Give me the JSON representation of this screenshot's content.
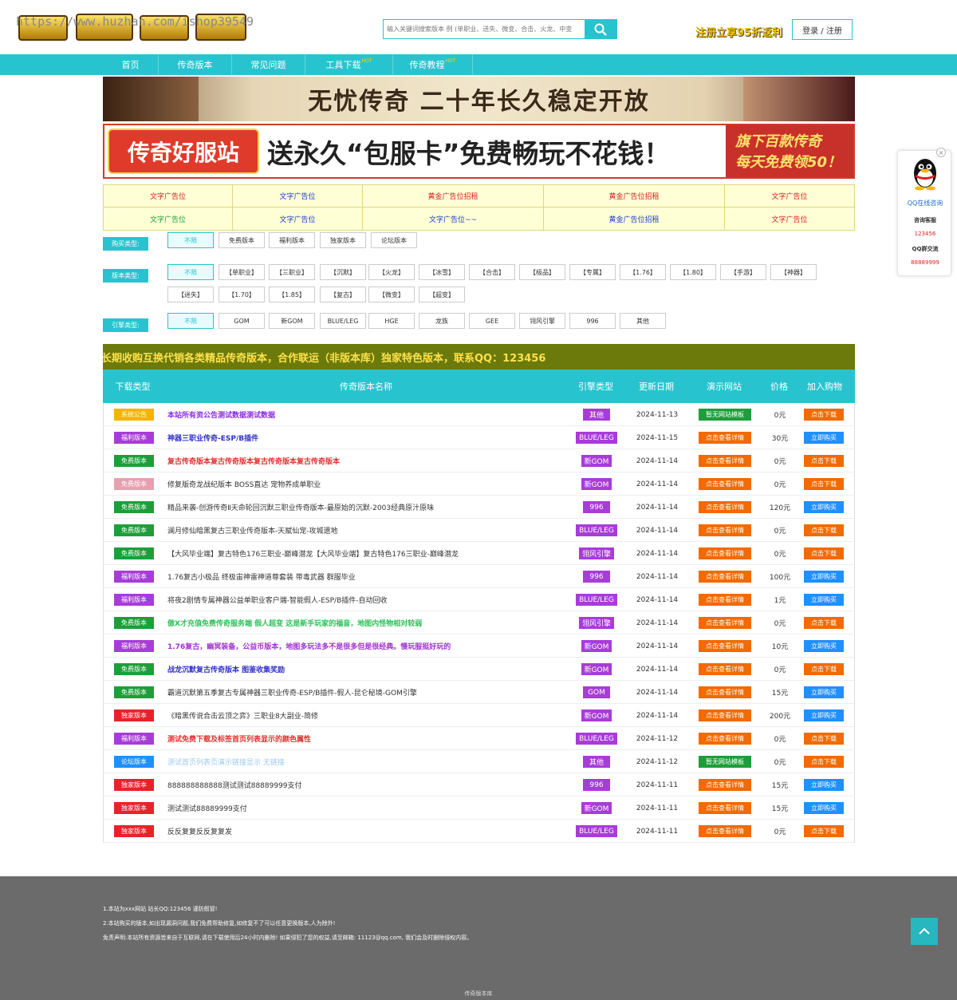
{
  "header": {
    "watermark": "https://www.huzhan.com/ishop39549",
    "search_placeholder": "输入关键词搜索版本 例 (单职业、送失、微变、合击、火龙、中变",
    "promo": "注册立享95折返利",
    "login": "登录 / 注册"
  },
  "nav": [
    {
      "label": "首页",
      "hot": ""
    },
    {
      "label": "传奇版本",
      "hot": ""
    },
    {
      "label": "常见问题",
      "hot": ""
    },
    {
      "label": "工具下载",
      "hot": "HOT"
    },
    {
      "label": "传奇教程",
      "hot": "HOT"
    }
  ],
  "banner1": "无忧传奇 二十年长久稳定开放",
  "banner2": {
    "badge": "传奇好服站",
    "main": "送永久“包服卡”免费畅玩不花钱！",
    "side1": "旗下百款传奇",
    "side2": "每天免费领50！"
  },
  "ads": [
    [
      "文字广告位",
      "文字广告位",
      "黄金广告位招租",
      "黄金广告位招租",
      "文字广告位"
    ],
    [
      "文字广告位",
      "文字广告位",
      "文字广告位~~",
      "黄金广告位招租",
      "文字广告位"
    ]
  ],
  "filters": {
    "buy": {
      "label": "购买类型:",
      "options": [
        "不限",
        "免费版本",
        "福利版本",
        "独家版本",
        "论坛版本"
      ]
    },
    "version": {
      "label": "版本类型:",
      "options": [
        "不限",
        "【单职业】",
        "【三职业】",
        "【沉默】",
        "【火龙】",
        "【冰雪】",
        "【合击】",
        "【极品】",
        "【专属】",
        "【1.76】",
        "【1.80】",
        "【手游】",
        "【神器】",
        "【迷失】",
        "【1.70】",
        "【1.85】",
        "【复古】",
        "【微变】",
        "【超变】"
      ]
    },
    "engine": {
      "label": "引擎类型:",
      "options": [
        "不限",
        "GOM",
        "新GOM",
        "BLUE/LEG",
        "HGE",
        "龙族",
        "GEE",
        "翎风引擎",
        "996",
        "其他"
      ]
    }
  },
  "ticker": "长期收购互换代销各类精品传奇版本，合作联运（非版本库）独家特色版本，联系QQ：123456",
  "table": {
    "headers": [
      "下载类型",
      "传奇版本名称",
      "引擎类型",
      "更新日期",
      "演示网站",
      "价格",
      "加入购物"
    ],
    "rows": [
      {
        "type": "系统公告",
        "typeColor": "#f5b400",
        "name": "本站所有资公告测试数据测试数据",
        "nameColor": "#8a2be2",
        "nameBold": true,
        "engine": "其他",
        "date": "2024-11-13",
        "demo": "暂无网站模板",
        "demoColor": "#1e9e3a",
        "price": "0元",
        "action": "点击下载",
        "actionColor": "#f26a00"
      },
      {
        "type": "福利版本",
        "typeColor": "#a83cd8",
        "name": "神器三职业传奇-ESP/B插件",
        "nameColor": "#3030c8",
        "nameBold": true,
        "engine": "BLUE/LEG",
        "date": "2024-11-15",
        "demo": "点击查看详情",
        "demoColor": "#f26a00",
        "price": "30元",
        "action": "立即购买",
        "actionColor": "#1e90ff"
      },
      {
        "type": "免费版本",
        "typeColor": "#1e9e3a",
        "name": "复古传奇版本复古传奇版本复古传奇版本复古传奇版本",
        "nameColor": "#e03030",
        "nameBold": true,
        "engine": "新GOM",
        "date": "2024-11-14",
        "demo": "点击查看详情",
        "demoColor": "#f26a00",
        "price": "0元",
        "action": "点击下载",
        "actionColor": "#f26a00"
      },
      {
        "type": "免费版本",
        "typeColor": "#e8a0b0",
        "name": "修复版奇龙战纪版本 BOSS直达 宠物养成单职业",
        "nameColor": "#333",
        "nameBold": false,
        "engine": "新GOM",
        "date": "2024-11-14",
        "demo": "点击查看详情",
        "demoColor": "#f26a00",
        "price": "0元",
        "action": "点击下载",
        "actionColor": "#f26a00"
      },
      {
        "type": "免费版本",
        "typeColor": "#1e9e3a",
        "name": "精品来袭-创游传奇Ⅱ天命轮回沉默三职业传奇版本-最原始的沉默-2003经典原汁原味",
        "nameColor": "#333",
        "nameBold": false,
        "engine": "996",
        "date": "2024-11-14",
        "demo": "点击查看详情",
        "demoColor": "#f26a00",
        "price": "120元",
        "action": "立即购买",
        "actionColor": "#1e90ff"
      },
      {
        "type": "免费版本",
        "typeColor": "#1e9e3a",
        "name": "澜月修仙暗黑复古三职业传奇版本-天赋仙宠-攻城遗地",
        "nameColor": "#333",
        "nameBold": false,
        "engine": "BLUE/LEG",
        "date": "2024-11-14",
        "demo": "点击查看详情",
        "demoColor": "#f26a00",
        "price": "0元",
        "action": "点击下载",
        "actionColor": "#f26a00"
      },
      {
        "type": "免费版本",
        "typeColor": "#1e9e3a",
        "name": "【大风毕业端】复古特色176三职业-巅峰潜龙【大风毕业端】复古特色176三职业-巅峰潜龙",
        "nameColor": "#333",
        "nameBold": false,
        "engine": "翎风引擎",
        "date": "2024-11-14",
        "demo": "点击查看详情",
        "demoColor": "#f26a00",
        "price": "0元",
        "action": "点击下载",
        "actionColor": "#f26a00"
      },
      {
        "type": "福利版本",
        "typeColor": "#a83cd8",
        "name": "1.76复古小极品 终极宙神雷神道尊套装 带毒武器 群服毕业",
        "nameColor": "#333",
        "nameBold": false,
        "engine": "996",
        "date": "2024-11-14",
        "demo": "点击查看详情",
        "demoColor": "#f26a00",
        "price": "100元",
        "action": "立即购买",
        "actionColor": "#1e90ff"
      },
      {
        "type": "福利版本",
        "typeColor": "#a83cd8",
        "name": "将夜2剧情专属神器公益单职业客户端-智能假人-ESP/B插件-自动回收",
        "nameColor": "#333",
        "nameBold": false,
        "engine": "BLUE/LEG",
        "date": "2024-11-14",
        "demo": "点击查看详情",
        "demoColor": "#f26a00",
        "price": "1元",
        "action": "立即购买",
        "actionColor": "#1e90ff"
      },
      {
        "type": "免费版本",
        "typeColor": "#1e9e3a",
        "name": "傲X才充值免费传奇服务端 假人超变 这是新手玩家的福音，地图内怪物相对较弱",
        "nameColor": "#2ec05a",
        "nameBold": true,
        "engine": "翎风引擎",
        "date": "2024-11-14",
        "demo": "点击查看详情",
        "demoColor": "#f26a00",
        "price": "0元",
        "action": "点击下载",
        "actionColor": "#f26a00"
      },
      {
        "type": "福利版本",
        "typeColor": "#a83cd8",
        "name": "1.76复古，幽冥装备，公益币版本，地图多玩法多不是很多但是很经典。慢玩服挺好玩的",
        "nameColor": "#a030d0",
        "nameBold": true,
        "engine": "新GOM",
        "date": "2024-11-14",
        "demo": "点击查看详情",
        "demoColor": "#f26a00",
        "price": "10元",
        "action": "立即购买",
        "actionColor": "#1e90ff"
      },
      {
        "type": "免费版本",
        "typeColor": "#1e9e3a",
        "name": "战龙沉默复古传奇版本 图鉴收集奖励",
        "nameColor": "#3030c8",
        "nameBold": true,
        "engine": "新GOM",
        "date": "2024-11-14",
        "demo": "点击查看详情",
        "demoColor": "#f26a00",
        "price": "0元",
        "action": "点击下载",
        "actionColor": "#f26a00"
      },
      {
        "type": "免费版本",
        "typeColor": "#1e9e3a",
        "name": "霸道沉默第五季复古专属神器三职业传奇-ESP/B插件-假人-昆仑秘境-GOM引擎",
        "nameColor": "#333",
        "nameBold": false,
        "engine": "GOM",
        "date": "2024-11-14",
        "demo": "点击查看详情",
        "demoColor": "#f26a00",
        "price": "15元",
        "action": "立即购买",
        "actionColor": "#1e90ff"
      },
      {
        "type": "独家版本",
        "typeColor": "#e8222a",
        "name": "《暗黑传说合击云顶之弈》三职业8大副业-简修",
        "nameColor": "#333",
        "nameBold": false,
        "engine": "新GOM",
        "date": "2024-11-14",
        "demo": "点击查看详情",
        "demoColor": "#f26a00",
        "price": "200元",
        "action": "立即购买",
        "actionColor": "#1e90ff"
      },
      {
        "type": "福利版本",
        "typeColor": "#a83cd8",
        "name": "测试免费下载及标签首页列表显示的颜色属性",
        "nameColor": "#e03030",
        "nameBold": true,
        "engine": "BLUE/LEG",
        "date": "2024-11-12",
        "demo": "点击查看详情",
        "demoColor": "#f26a00",
        "price": "0元",
        "action": "点击下载",
        "actionColor": "#f26a00"
      },
      {
        "type": "论坛版本",
        "typeColor": "#1e90ff",
        "name": "测试首页列表页演示链接显示 无链接",
        "nameColor": "#9ec8f0",
        "nameBold": false,
        "engine": "其他",
        "date": "2024-11-12",
        "demo": "暂无网站模板",
        "demoColor": "#1e9e3a",
        "price": "0元",
        "action": "点击下载",
        "actionColor": "#f26a00"
      },
      {
        "type": "独家版本",
        "typeColor": "#e8222a",
        "name": "888888888888测试测试88889999支付",
        "nameColor": "#333",
        "nameBold": false,
        "engine": "996",
        "date": "2024-11-11",
        "demo": "点击查看详情",
        "demoColor": "#f26a00",
        "price": "15元",
        "action": "立即购买",
        "actionColor": "#1e90ff"
      },
      {
        "type": "独家版本",
        "typeColor": "#e8222a",
        "name": "测试测试88889999支付",
        "nameColor": "#333",
        "nameBold": false,
        "engine": "新GOM",
        "date": "2024-11-11",
        "demo": "点击查看详情",
        "demoColor": "#f26a00",
        "price": "15元",
        "action": "立即购买",
        "actionColor": "#1e90ff"
      },
      {
        "type": "独家版本",
        "typeColor": "#e8222a",
        "name": "反反复复反反复复发",
        "nameColor": "#333",
        "nameBold": false,
        "engine": "BLUE/LEG",
        "date": "2024-11-11",
        "demo": "点击查看详情",
        "demoColor": "#f26a00",
        "price": "0元",
        "action": "点击下载",
        "actionColor": "#f26a00"
      }
    ]
  },
  "footer": {
    "line1": "1.本站为xxx网站 站长QQ:123456 谨防假冒!",
    "line2": "2.本站购买的版本,如出现漏洞问题,我们免费帮助修复,如修复不了可以任意更换版本,人为除外!",
    "line3": "免责声明:本站所有资源皆来自于互联网,请在下载使用后24小时内删除! 如果侵犯了您的权益,请至邮箱: 11123@qq.com, 我们会及时删除侵权内容。",
    "bottom": "传奇版本库"
  },
  "qq_widget": {
    "online": "QQ在线咨询",
    "service": "咨询客服",
    "service_no": "123456",
    "group": "QQ群交流",
    "group_no": "88889999",
    "close": "×"
  },
  "colors": {
    "accent": "#27c4cf"
  }
}
